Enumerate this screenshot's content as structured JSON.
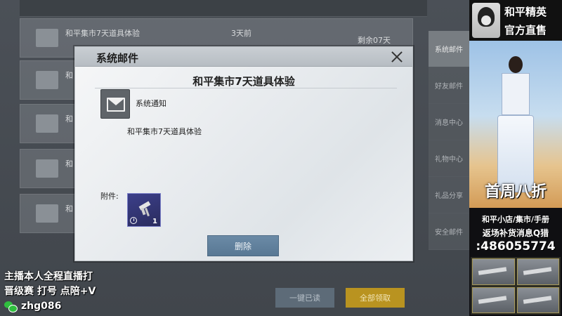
{
  "background": {
    "rows": [
      {
        "title": "和平集市7天道具体验",
        "time": "3天前",
        "remain": "剩余07天"
      },
      {
        "title": "和",
        "time": "",
        "remain": ""
      },
      {
        "title": "和",
        "time": "",
        "remain": ""
      },
      {
        "title": "和",
        "time": "",
        "remain": ""
      },
      {
        "title": "和",
        "time": "",
        "remain": ""
      }
    ],
    "side_tabs": [
      "系统邮件",
      "好友邮件",
      "消息中心",
      "礼物中心",
      "礼品分享",
      "安全邮件"
    ],
    "mark_read_label": "一键已读",
    "claim_all_label": "全部领取"
  },
  "modal": {
    "title": "系统邮件",
    "heading": "和平集市7天道具体验",
    "sender": "系统通知",
    "body": "和平集市7天道具体验",
    "attachment_label": "附件:",
    "attachment_count": "1",
    "delete_label": "删除"
  },
  "overlay": {
    "line1": "主播本人全程直播打",
    "line2": "晋级赛 打号 点陪+V",
    "wechat": "zhg086"
  },
  "ad": {
    "title_line1": "和平精英",
    "title_line2": "官方直售",
    "promo": "首周八折",
    "line1": "和平小店/集市/手册",
    "line2": "返场补货消息Q猎",
    "line3": ":486055774"
  }
}
